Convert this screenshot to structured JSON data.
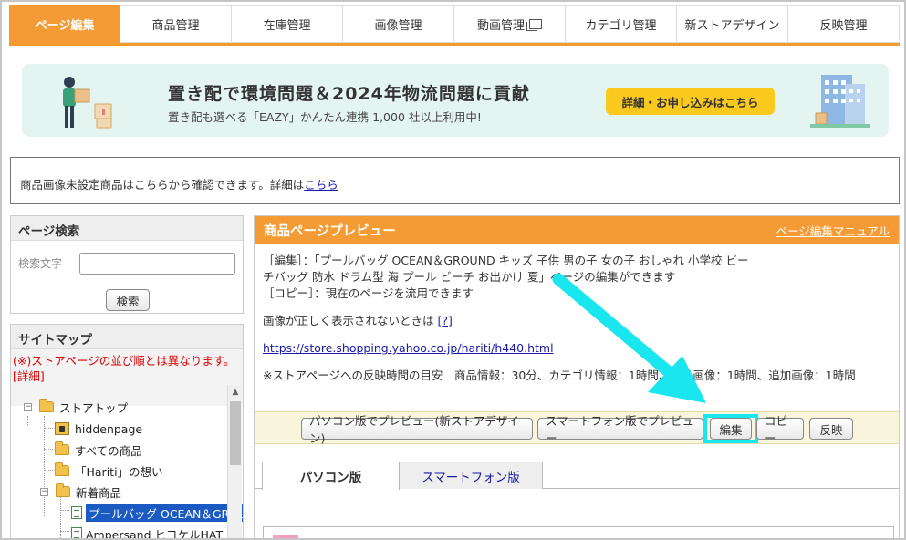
{
  "nav": {
    "tabs": [
      {
        "label": "ページ編集",
        "active": true
      },
      {
        "label": "商品管理"
      },
      {
        "label": "在庫管理"
      },
      {
        "label": "画像管理"
      },
      {
        "label": "動画管理"
      },
      {
        "label": "カテゴリ管理"
      },
      {
        "label": "新ストアデザイン"
      },
      {
        "label": "反映管理"
      }
    ]
  },
  "banner": {
    "title": "置き配で環境問題＆2024年物流問題に貢献",
    "subtitle": "置き配も選べる「EAZY」かんたん連携 1,000 社以上利用中!",
    "cta": "詳細・お申し込みはこちら",
    "bg_color": "#e4f5f1",
    "cta_color": "#f9c91e"
  },
  "notice": {
    "text": "商品画像未設定商品はこちらから確認できます。詳細は",
    "link": "こちら"
  },
  "page_search": {
    "heading": "ページ検索",
    "field_label": "検索文字",
    "field_value": "",
    "button": "検索"
  },
  "sitemap": {
    "heading": "サイトマップ",
    "warning": "(※)ストアページの並び順とは異なります。",
    "warning_link": "[詳細]",
    "tree": {
      "root": "ストアトップ",
      "items": [
        {
          "label": "hiddenpage",
          "icon": "lock-folder-icon"
        },
        {
          "label": "すべての商品",
          "icon": "folder-icon"
        },
        {
          "label": "「Hariti」の想い",
          "icon": "folder-icon"
        },
        {
          "label": "新着商品",
          "icon": "folder-icon"
        }
      ],
      "children": [
        {
          "label": "プールバッグ OCEAN＆GROUND キッズ",
          "selected": true
        },
        {
          "label": "Ampersand ヒヨケルHAT キッズ"
        }
      ]
    }
  },
  "preview": {
    "heading": "商品ページプレビュー",
    "manual_link": "ページ編集マニュアル",
    "desc_line1": "［編集］：「プールバッグ OCEAN＆GROUND キッズ 子供 男の子 女の子 おしゃれ 小学校 ビー",
    "desc_line2": "チバッグ 防水 ドラム型 海 プール ビーチ お出かけ 夏」ページの編集ができます",
    "desc_line3": "［コピー］：現在のページを流用できます",
    "image_note": "画像が正しく表示されないときは",
    "image_note_link": "[?]",
    "url": "https://store.shopping.yahoo.co.jp/hariti/h440.html",
    "timing": "※ストアページへの反映時間の目安　商品情報：30分、カテゴリ情報：1時間、商品画像：1時間、追加画像：1時間",
    "buttons": {
      "pc_preview": "パソコン版でプレビュー(新ストアデザイン)",
      "sp_preview": "スマートフォン版でプレビュー",
      "edit": "編集",
      "copy": "コピー",
      "publish": "反映"
    },
    "tabs": [
      {
        "label": "パソコン版",
        "active": true
      },
      {
        "label": "スマートフォン版"
      }
    ],
    "highlight_color": "#19e6ef"
  }
}
